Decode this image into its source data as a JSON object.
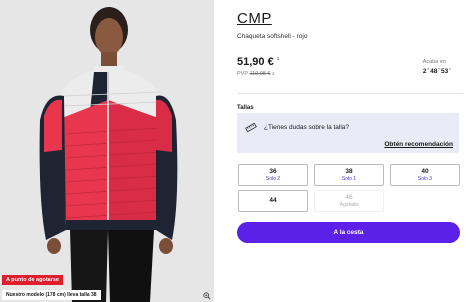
{
  "image": {
    "sale_badge": "A punto de agotarse",
    "model_note": "Nuestro modelo (178 cm) lleva talla 38",
    "zoom_icon": "magnifier-icon"
  },
  "product": {
    "brand": "CMP",
    "name": "Chaqueta softshell - rojo"
  },
  "pricing": {
    "price": "51,90 €",
    "price_marker": "1",
    "pvp_label": "PVP",
    "pvp_old": "119,98 €",
    "pvp_marker": "2",
    "ends_label": "Acaba en",
    "ends_value": "2 ̊ 48 ̊ 53 ̊"
  },
  "sizes": {
    "title": "Tallas",
    "help_text": "¿Tienes dudas sobre la talla?",
    "help_link": "Obtén recomendación",
    "help_icon": "ruler-icon",
    "options": [
      {
        "size": "36",
        "stock": "Solo 2",
        "available": true
      },
      {
        "size": "38",
        "stock": "Solo 1",
        "available": true
      },
      {
        "size": "40",
        "stock": "Solo 3",
        "available": true
      },
      {
        "size": "44",
        "stock": "",
        "available": true
      },
      {
        "size": "46",
        "stock": "Agotado",
        "available": false
      }
    ]
  },
  "cart": {
    "button_label": "A la cesta"
  },
  "colors": {
    "accent": "#5b21e8",
    "sale_badge": "#e01e2b",
    "help_background": "#ebeaf7",
    "jacket_red": "#e8364f",
    "jacket_white": "#ececec",
    "jacket_navy": "#1f2433"
  }
}
